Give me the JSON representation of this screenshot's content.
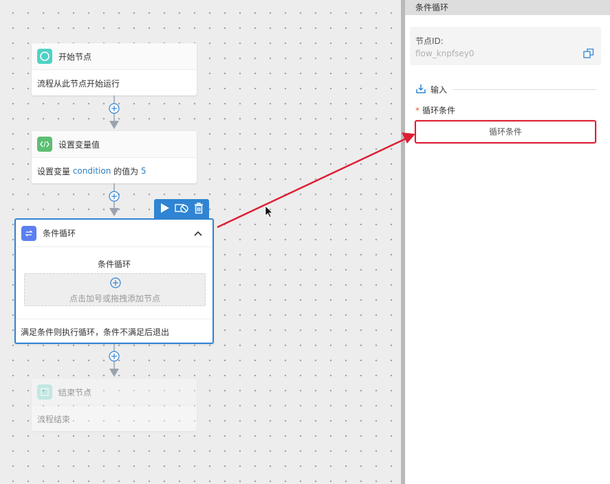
{
  "canvas": {
    "start_node": {
      "title": "开始节点",
      "desc": "流程从此节点开始运行",
      "icon": "circle-icon"
    },
    "setvar_node": {
      "title": "设置变量值",
      "desc_prefix": "设置变量 ",
      "var_name": "condition",
      "desc_mid": " 的值为 ",
      "var_value": "5",
      "icon": "code-icon"
    },
    "loop_node": {
      "title": "条件循环",
      "inner_title": "条件循环",
      "drop_hint": "点击加号或拖拽添加节点",
      "footer": "满足条件则执行循环，条件不满足后退出",
      "icon": "loop-icon",
      "toolbar": [
        "play-icon",
        "skip-icon",
        "trash-icon"
      ]
    },
    "end_node": {
      "title": "结束节点",
      "desc": "流程结束",
      "icon": "square-icon"
    }
  },
  "panel": {
    "title": "条件循环",
    "node_id_label": "节点ID:",
    "node_id_value": "flow_knpfsey0",
    "input_section_label": "输入",
    "condition_label": "循环条件",
    "condition_button": "循环条件"
  },
  "colors": {
    "accent": "#2f84d3",
    "start_icon": "#4fd1c5",
    "code_icon": "#5cbf73",
    "loop_icon": "#5b7ff0",
    "annotation": "#de1e35"
  }
}
